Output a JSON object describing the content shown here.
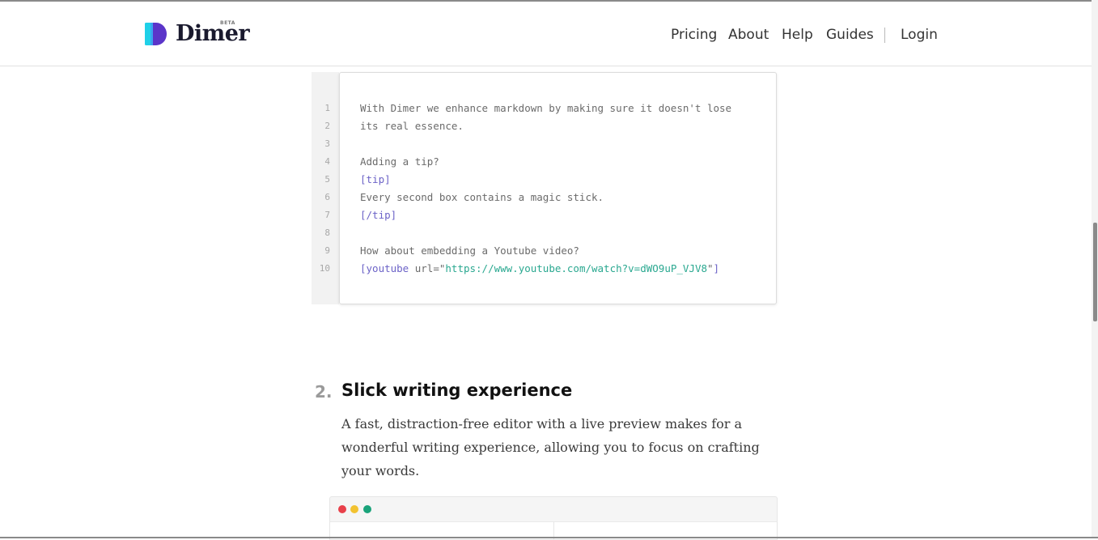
{
  "header": {
    "logo_text": "Dimer",
    "logo_badge": "BETA",
    "nav": {
      "pricing": "Pricing",
      "about": "About",
      "help": "Help",
      "guides": "Guides",
      "login": "Login"
    }
  },
  "code_example": {
    "line_numbers": [
      "1",
      "2",
      "3",
      "4",
      "5",
      "6",
      "7",
      "8",
      "9",
      "10"
    ],
    "lines": {
      "l1": "With Dimer we enhance markdown by making sure it doesn't lose",
      "l2": "its real essence.",
      "l3": "",
      "l4": "Adding a tip?",
      "l5": "[tip]",
      "l6": "Every second box contains a magic stick.",
      "l7": "[/tip]",
      "l8": "",
      "l9": "How about embedding a Youtube video?",
      "l10_open": "[youtube",
      "l10_attr": " url=",
      "l10_q1": "\"",
      "l10_url": "https://www.youtube.com/watch?v=dWO9uP_VJV8",
      "l10_q2": "\"",
      "l10_close": "]"
    }
  },
  "feature": {
    "number": "2.",
    "title": "Slick writing experience",
    "description": "A fast, distraction-free editor with a live preview makes for a wonderful writing experience, allowing you to focus on crafting your words."
  },
  "colors": {
    "accent_purple": "#6c63c7",
    "code_string": "#2aa890",
    "window_dot_red": "#e8404a",
    "window_dot_yellow": "#f2c230",
    "window_dot_green": "#1aa37a"
  }
}
